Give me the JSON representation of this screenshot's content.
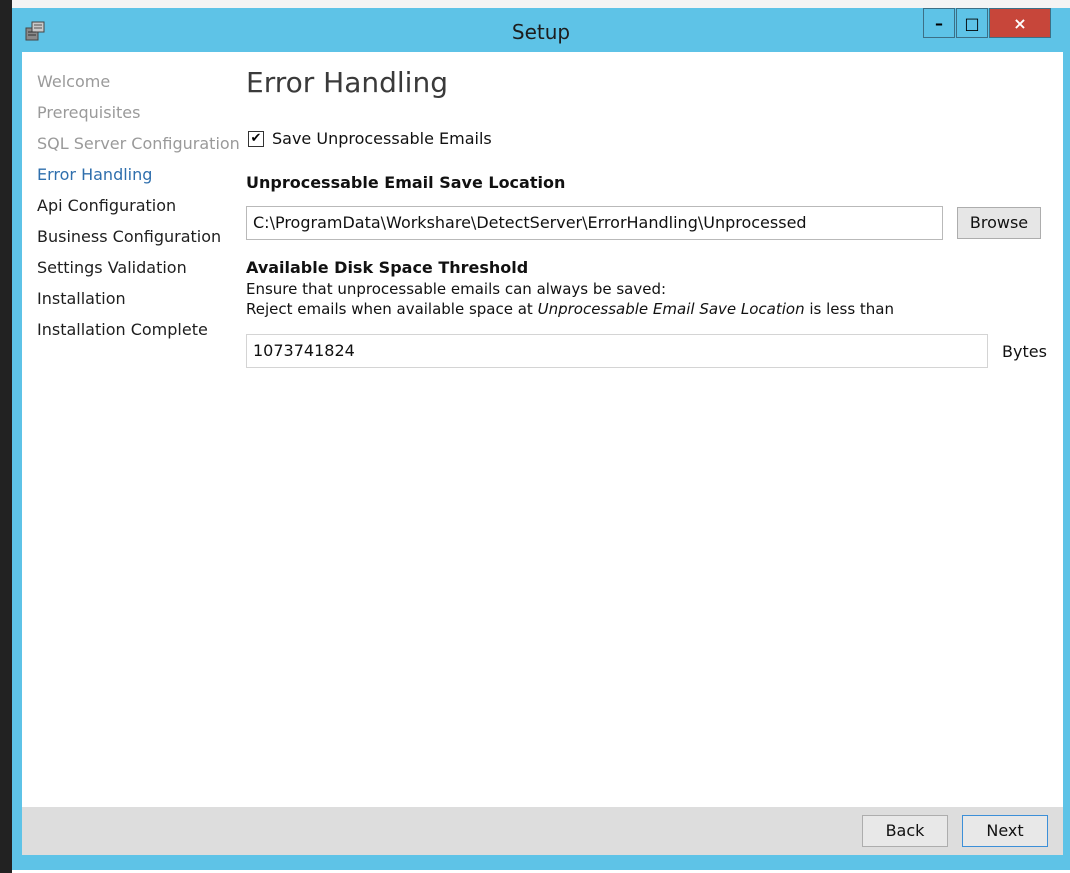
{
  "window": {
    "title": "Setup",
    "minimize_glyph": "–",
    "maximize_glyph": "□",
    "close_glyph": "×",
    "accent_color": "#5ec3e7",
    "close_color": "#c7463a"
  },
  "sidebar": {
    "items": [
      {
        "label": "Welcome",
        "state": "done"
      },
      {
        "label": "Prerequisites",
        "state": "done"
      },
      {
        "label": "SQL Server Configuration",
        "state": "done"
      },
      {
        "label": "Error Handling",
        "state": "active"
      },
      {
        "label": "Api Configuration",
        "state": "pending"
      },
      {
        "label": "Business Configuration",
        "state": "pending"
      },
      {
        "label": "Settings Validation",
        "state": "pending"
      },
      {
        "label": "Installation",
        "state": "pending"
      },
      {
        "label": "Installation Complete",
        "state": "pending"
      }
    ]
  },
  "main": {
    "heading": "Error Handling",
    "save_checkbox": {
      "label": "Save Unprocessable Emails",
      "checked": true,
      "check_glyph": "✔"
    },
    "save_location_label": "Unprocessable Email Save Location",
    "save_location_value": "C:\\ProgramData\\Workshare\\DetectServer\\ErrorHandling\\Unprocessed",
    "browse_label": "Browse",
    "threshold_label": "Available Disk Space Threshold",
    "threshold_desc_1": "Ensure that unprocessable emails can always be saved:",
    "threshold_desc_2_prefix": "Reject emails when available space at ",
    "threshold_desc_2_em": "Unprocessable Email Save Location",
    "threshold_desc_2_suffix": " is less than",
    "threshold_value": "1073741824",
    "threshold_unit": "Bytes"
  },
  "footer": {
    "back_label": "Back",
    "next_label": "Next"
  }
}
